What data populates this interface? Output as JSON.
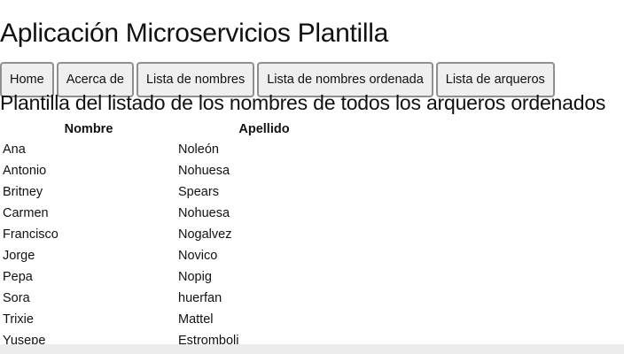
{
  "app": {
    "title": "Aplicación Microservicios Plantilla"
  },
  "nav": {
    "tabs": [
      {
        "label": "Home"
      },
      {
        "label": "Acerca de"
      },
      {
        "label": "Lista de nombres"
      },
      {
        "label": "Lista de nombres ordenada"
      },
      {
        "label": "Lista de arqueros"
      }
    ]
  },
  "main": {
    "section_title": "Plantilla del listado de los nombres de todos los arqueros ordenados",
    "table": {
      "headers": [
        "Nombre",
        "Apellido"
      ],
      "rows": [
        [
          "Ana",
          "Noleón"
        ],
        [
          "Antonio",
          "Nohuesa"
        ],
        [
          "Britney",
          "Spears"
        ],
        [
          "Carmen",
          "Nohuesa"
        ],
        [
          "Francisco",
          "Nogalvez"
        ],
        [
          "Jorge",
          "Novico"
        ],
        [
          "Pepa",
          "Nopig"
        ],
        [
          "Sora",
          "huerfan"
        ],
        [
          "Trixie",
          "Mattel"
        ],
        [
          "Yusepe",
          "Estromboli"
        ]
      ]
    }
  }
}
